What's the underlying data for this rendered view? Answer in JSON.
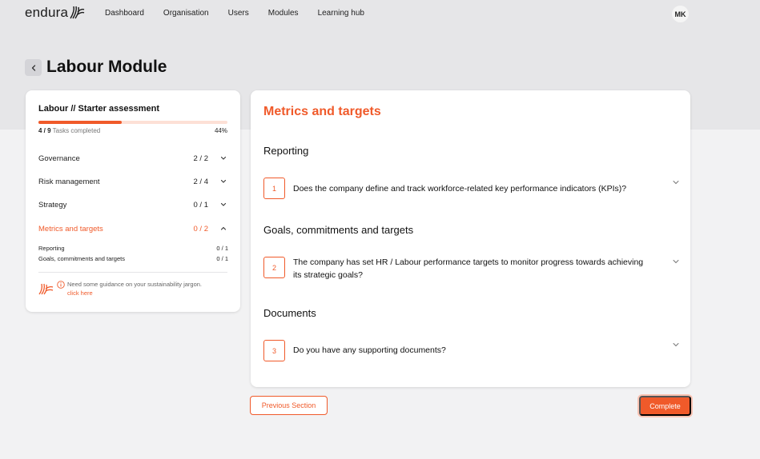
{
  "nav": {
    "logo_text": "endura",
    "links": [
      "Dashboard",
      "Organisation",
      "Users",
      "Modules",
      "Learning hub"
    ],
    "avatar_initials": "MK"
  },
  "page": {
    "title": "Labour Module"
  },
  "assessment": {
    "title": "Labour // Starter assessment",
    "progress_fraction": 0.44,
    "tasks_done": "4 / 9",
    "tasks_label": "Tasks completed",
    "percent_label": "44%",
    "sections": [
      {
        "label": "Governance",
        "count": "2 / 2",
        "expanded": false
      },
      {
        "label": "Risk management",
        "count": "2 / 4",
        "expanded": false
      },
      {
        "label": "Strategy",
        "count": "0 / 1",
        "expanded": false
      },
      {
        "label": "Metrics and targets",
        "count": "0 / 2",
        "expanded": true
      }
    ],
    "subsections": [
      {
        "label": "Reporting",
        "count": "0 / 1"
      },
      {
        "label": "Goals, commitments and targets",
        "count": "0 / 1"
      }
    ],
    "guidance_text": "Need some guidance on your sustainability jargon.",
    "guidance_link": "click here"
  },
  "content": {
    "title": "Metrics and targets",
    "groups": [
      {
        "title": "Reporting",
        "question": {
          "num": "1",
          "text": "Does the company define and track workforce-related key performance indicators (KPIs)?"
        }
      },
      {
        "title": "Goals, commitments and targets",
        "question": {
          "num": "2",
          "text": "The company has set HR / Labour performance targets to monitor progress towards achieving its strategic goals?"
        }
      },
      {
        "title": "Documents",
        "question": {
          "num": "3",
          "text": "Do you have any supporting documents?"
        }
      }
    ]
  },
  "actions": {
    "previous_label": "Previous Section",
    "complete_label": "Complete"
  },
  "colors": {
    "accent": "#f05a2a",
    "accent_light": "#fde0d6",
    "header_band": "#e6e6e8",
    "page_bg": "#f2f2f3"
  },
  "icons": {
    "logo": "endura-wing-icon",
    "back": "chevron-left-icon",
    "collapsed": "chevron-down-icon",
    "expanded": "chevron-up-icon",
    "info": "info-icon"
  }
}
